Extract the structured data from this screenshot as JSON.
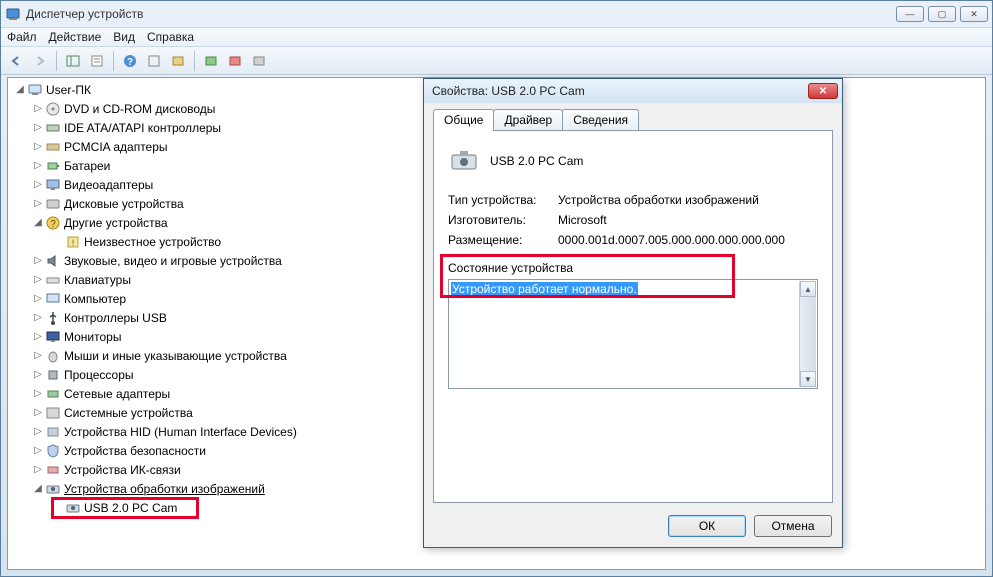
{
  "window": {
    "title": "Диспетчер устройств",
    "controls": {
      "min": "—",
      "max": "▢",
      "close": "✕"
    }
  },
  "menu": {
    "file": "Файл",
    "action": "Действие",
    "view": "Вид",
    "help": "Справка"
  },
  "tree": {
    "root": "User-ПК",
    "nodes": [
      {
        "label": "DVD и CD-ROM дисководы",
        "icon": "disc"
      },
      {
        "label": "IDE ATA/ATAPI контроллеры",
        "icon": "ide"
      },
      {
        "label": "PCMCIA адаптеры",
        "icon": "pcmcia"
      },
      {
        "label": "Батареи",
        "icon": "battery"
      },
      {
        "label": "Видеоадаптеры",
        "icon": "display"
      },
      {
        "label": "Дисковые устройства",
        "icon": "disk"
      }
    ],
    "other_devices": {
      "label": "Другие устройства",
      "child": "Неизвестное устройство"
    },
    "nodes2": [
      {
        "label": "Звуковые, видео и игровые устройства",
        "icon": "sound"
      },
      {
        "label": "Клавиатуры",
        "icon": "keyboard"
      },
      {
        "label": "Компьютер",
        "icon": "computer"
      },
      {
        "label": "Контроллеры USB",
        "icon": "usb"
      },
      {
        "label": "Мониторы",
        "icon": "monitor"
      },
      {
        "label": "Мыши и иные указывающие устройства",
        "icon": "mouse"
      },
      {
        "label": "Процессоры",
        "icon": "cpu"
      },
      {
        "label": "Сетевые адаптеры",
        "icon": "network"
      },
      {
        "label": "Системные устройства",
        "icon": "system"
      },
      {
        "label": "Устройства HID (Human Interface Devices)",
        "icon": "hid"
      },
      {
        "label": "Устройства безопасности",
        "icon": "security"
      },
      {
        "label": "Устройства ИК-связи",
        "icon": "ir"
      }
    ],
    "imaging": {
      "label": "Устройства обработки изображений",
      "child": "USB 2.0 PC Cam"
    }
  },
  "dialog": {
    "title": "Свойства: USB 2.0 PC Cam",
    "tabs": {
      "general": "Общие",
      "driver": "Драйвер",
      "details": "Сведения"
    },
    "device_name": "USB 2.0 PC Cam",
    "rows": {
      "type_label": "Тип устройства:",
      "type_value": "Устройства обработки изображений",
      "mfr_label": "Изготовитель:",
      "mfr_value": "Microsoft",
      "loc_label": "Размещение:",
      "loc_value": "0000.001d.0007.005.000.000.000.000.000"
    },
    "status_label": "Состояние устройства",
    "status_text": "Устройство работает нормально.",
    "buttons": {
      "ok": "ОК",
      "cancel": "Отмена"
    }
  }
}
